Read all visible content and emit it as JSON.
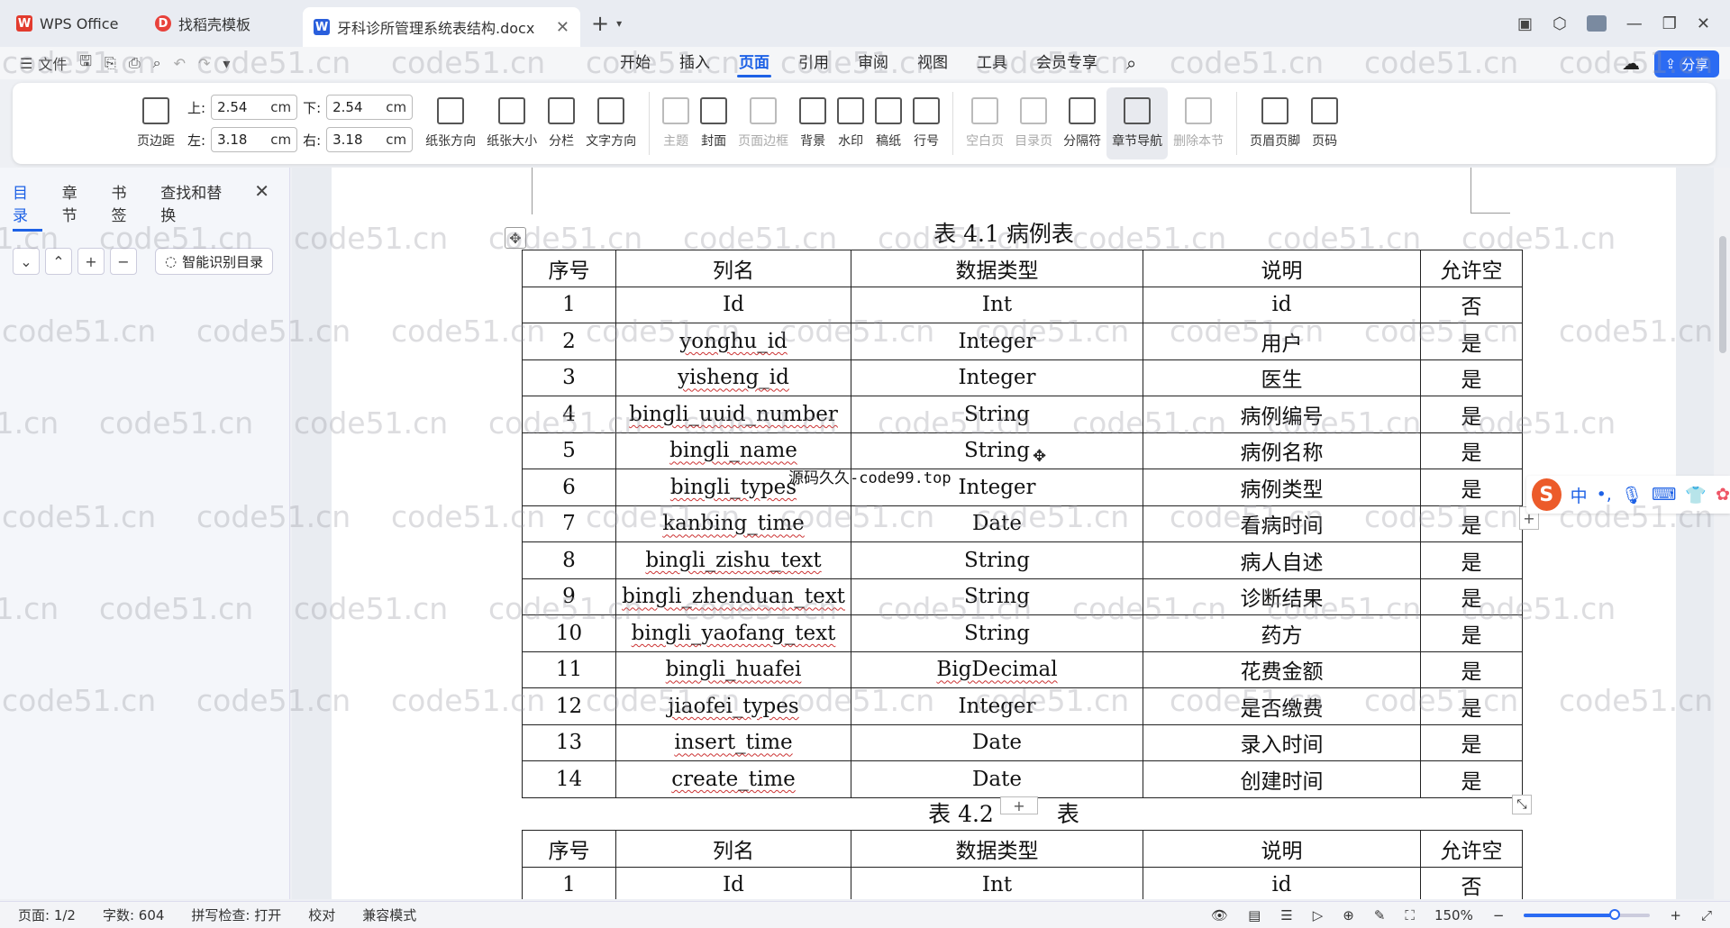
{
  "tabs": [
    {
      "label": "WPS Office",
      "icon": "wps-logo-icon"
    },
    {
      "label": "找稻壳模板",
      "icon": "docer-icon"
    },
    {
      "label": "牙科诊所管理系统表结构.docx",
      "icon": "word-doc-icon"
    }
  ],
  "menu": {
    "file": "文件",
    "items": [
      "开始",
      "插入",
      "页面",
      "引用",
      "审阅",
      "视图",
      "工具",
      "会员专享"
    ],
    "active": "页面",
    "share": "分享"
  },
  "ribbon": {
    "margins_btn": "页边距",
    "top_label": "上:",
    "top_value": "2.54",
    "bottom_label": "下:",
    "bottom_value": "2.54",
    "left_label": "左:",
    "left_value": "3.18",
    "right_label": "右:",
    "right_value": "3.18",
    "unit": "cm",
    "buttons": [
      "纸张方向",
      "纸张大小",
      "分栏",
      "文字方向"
    ],
    "buttons2": [
      "主题",
      "封面",
      "页面边框",
      "背景",
      "水印",
      "稿纸",
      "行号"
    ],
    "buttons3": [
      "空白页",
      "目录页",
      "分隔符",
      "章节导航",
      "删除本节"
    ],
    "buttons4": [
      "页眉页脚",
      "页码"
    ]
  },
  "nav": {
    "tabs": [
      "目录",
      "章节",
      "书签",
      "查找和替换"
    ],
    "smart": "智能识别目录"
  },
  "table1": {
    "caption": "表 4.1 病例表",
    "headers": [
      "序号",
      "列名",
      "数据类型",
      "说明",
      "允许空"
    ],
    "rows": [
      [
        "1",
        "Id",
        "Int",
        "id",
        "否"
      ],
      [
        "2",
        "yonghu_id",
        "Integer",
        "用户",
        "是"
      ],
      [
        "3",
        "yisheng_id",
        "Integer",
        "医生",
        "是"
      ],
      [
        "4",
        "bingli_uuid_number",
        "String",
        "病例编号",
        "是"
      ],
      [
        "5",
        "bingli_name",
        "String",
        "病例名称",
        "是"
      ],
      [
        "6",
        "bingli_types",
        "Integer",
        "病例类型",
        "是"
      ],
      [
        "7",
        "kanbing_time",
        "Date",
        "看病时间",
        "是"
      ],
      [
        "8",
        "bingli_zishu_text",
        "String",
        "病人自述",
        "是"
      ],
      [
        "9",
        "bingli_zhenduan_text",
        "String",
        "诊断结果",
        "是"
      ],
      [
        "10",
        "bingli_yaofang_text",
        "String",
        "药方",
        "是"
      ],
      [
        "11",
        "bingli_huafei",
        "BigDecimal",
        "花费金额",
        "是"
      ],
      [
        "12",
        "jiaofei_types",
        "Integer",
        "是否缴费",
        "是"
      ],
      [
        "13",
        "insert_time",
        "Date",
        "录入时间",
        "是"
      ],
      [
        "14",
        "create_time",
        "Date",
        "创建时间",
        "是"
      ]
    ]
  },
  "table2": {
    "caption_a": "表 4.2",
    "caption_b": "表",
    "headers": [
      "序号",
      "列名",
      "数据类型",
      "说明",
      "允许空"
    ],
    "rows": [
      [
        "1",
        "Id",
        "Int",
        "id",
        "否"
      ]
    ]
  },
  "overlay_text": "源码久久-code99.top",
  "watermark": "code51.cn",
  "ime": {
    "lang": "中"
  },
  "status": {
    "page": "页面: 1/2",
    "words": "字数: 604",
    "spell": "拼写检查: 打开",
    "proof": "校对",
    "compat": "兼容模式",
    "zoom": "150%",
    "zoom_fraction": 0.72
  }
}
